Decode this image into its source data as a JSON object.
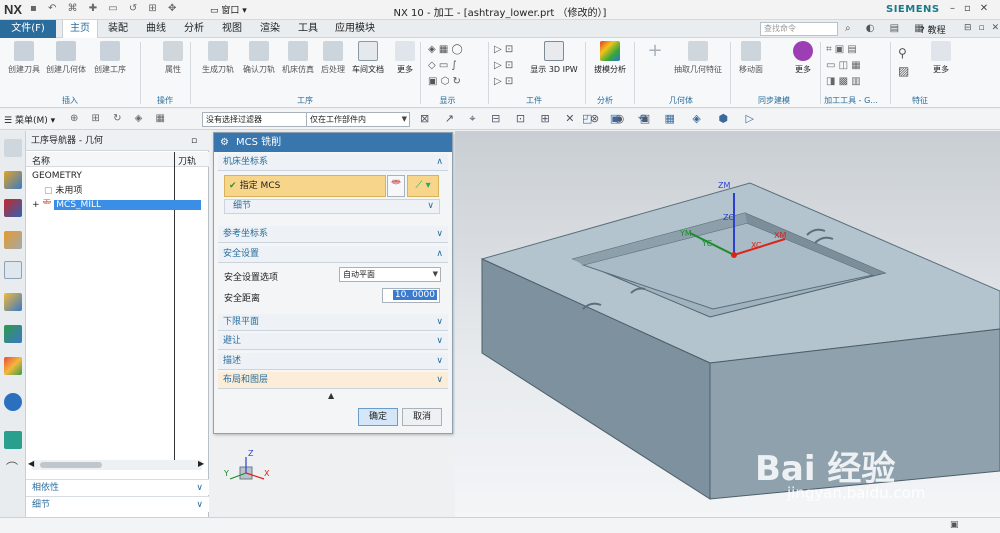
{
  "app": {
    "logo": "NX",
    "title": "NX 10 - 加工 - [ashtray_lower.prt （修改的）]",
    "brand": "SIEMENS",
    "window_menu": "窗口"
  },
  "tabs": {
    "file": "文件(F)",
    "items": [
      "主页",
      "装配",
      "曲线",
      "分析",
      "视图",
      "渲染",
      "工具",
      "应用模块"
    ],
    "active": "主页"
  },
  "search": {
    "placeholder": "查找命令"
  },
  "help": "教程",
  "ribbon": {
    "buttons": [
      {
        "label": "创建刀具"
      },
      {
        "label": "创建几何体"
      },
      {
        "label": "创建工序"
      },
      {
        "label": "属性"
      },
      {
        "label": "生成刀轨"
      },
      {
        "label": "确认刀轨"
      },
      {
        "label": "机床仿真"
      },
      {
        "label": "后处理"
      },
      {
        "label": "车间文档"
      },
      {
        "label": "更多"
      },
      {
        "label": "显示 3D IPW"
      },
      {
        "label": "拔模分析"
      },
      {
        "label": "抽取几何特征"
      },
      {
        "label": "移动面"
      },
      {
        "label": "更多"
      },
      {
        "label": "更多"
      }
    ],
    "groups": [
      "插入",
      "操作",
      "工序",
      "显示",
      "工件",
      "分析",
      "几何体",
      "同步建模",
      "加工工具 - G...",
      "特征"
    ]
  },
  "toolbar2": {
    "menu": "菜单(M)",
    "filter": "没有选择过滤器",
    "scope": "仅在工作部件内"
  },
  "navigator": {
    "title": "工序导航器 - 几何",
    "col_name": "名称",
    "col_path": "刀轨",
    "rows": [
      {
        "label": "GEOMETRY"
      },
      {
        "label": "未用项"
      },
      {
        "label": "MCS_MILL",
        "selected": true
      }
    ],
    "sections": [
      "相依性",
      "细节"
    ]
  },
  "dialog": {
    "title": "MCS 铣削",
    "sections": {
      "machine_csys": "机床坐标系",
      "specify_mcs": "指定 MCS",
      "details": "细节",
      "ref_csys": "参考坐标系",
      "safety": "安全设置",
      "safety_option_label": "安全设置选项",
      "safety_option_value": "自动平面",
      "safety_distance_label": "安全距离",
      "safety_distance_value": "10. 0000",
      "lower_plane": "下限平面",
      "avoid": "避让",
      "description": "描述",
      "layout": "布局和图层"
    },
    "ok": "确定",
    "cancel": "取消"
  },
  "viewport": {
    "axis_labels": [
      "ZM",
      "ZC",
      "YM",
      "YC",
      "XC",
      "XM"
    ],
    "triad_labels": [
      "Y",
      "Z",
      "X"
    ]
  },
  "watermark": {
    "text": "Bai 经验",
    "url": "jingyan.baidu.com"
  }
}
